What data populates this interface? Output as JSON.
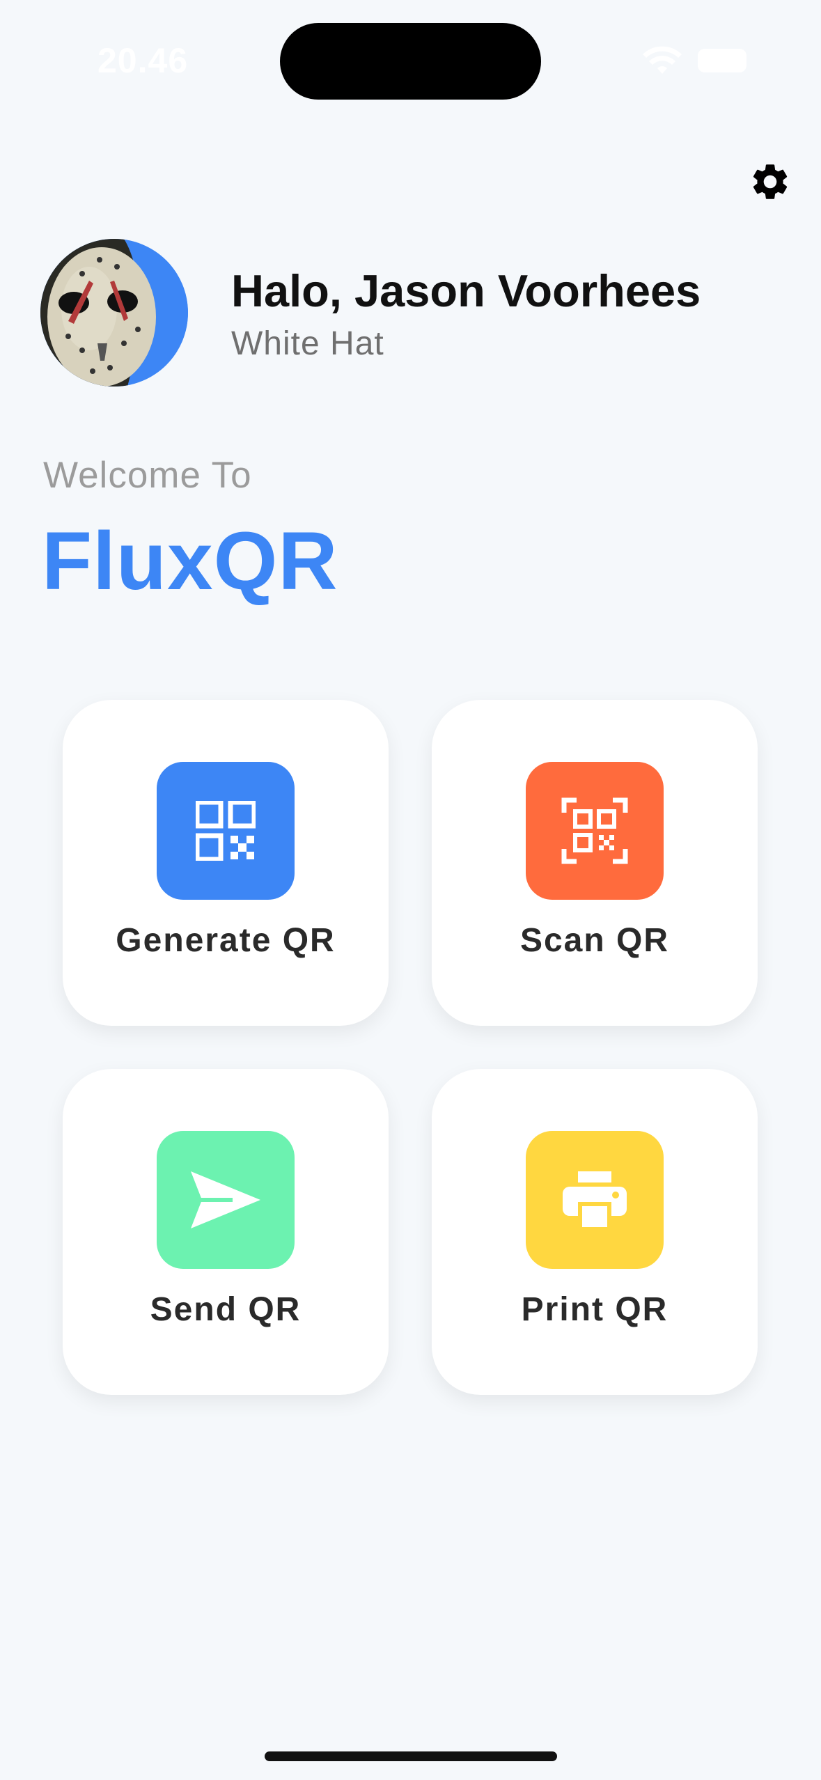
{
  "status_bar": {
    "time": "20.46",
    "wifi_icon": "wifi-icon",
    "battery_icon": "battery-icon"
  },
  "header": {
    "settings_icon": "gear-icon",
    "greeting": "Halo, Jason Voorhees",
    "role": "White Hat",
    "avatar_accent_color": "#3D86F5"
  },
  "hero": {
    "welcome": "Welcome To",
    "brand": "FluxQR",
    "brand_color": "#3D86F5"
  },
  "menu": {
    "items": [
      {
        "label": "Generate QR",
        "icon": "qr-code-icon",
        "color": "#3D86F5"
      },
      {
        "label": "Scan QR",
        "icon": "qr-scan-icon",
        "color": "#FF6B3D"
      },
      {
        "label": "Send QR",
        "icon": "send-icon",
        "color": "#6CF2B0"
      },
      {
        "label": "Print QR",
        "icon": "printer-icon",
        "color": "#FFD740"
      }
    ]
  }
}
